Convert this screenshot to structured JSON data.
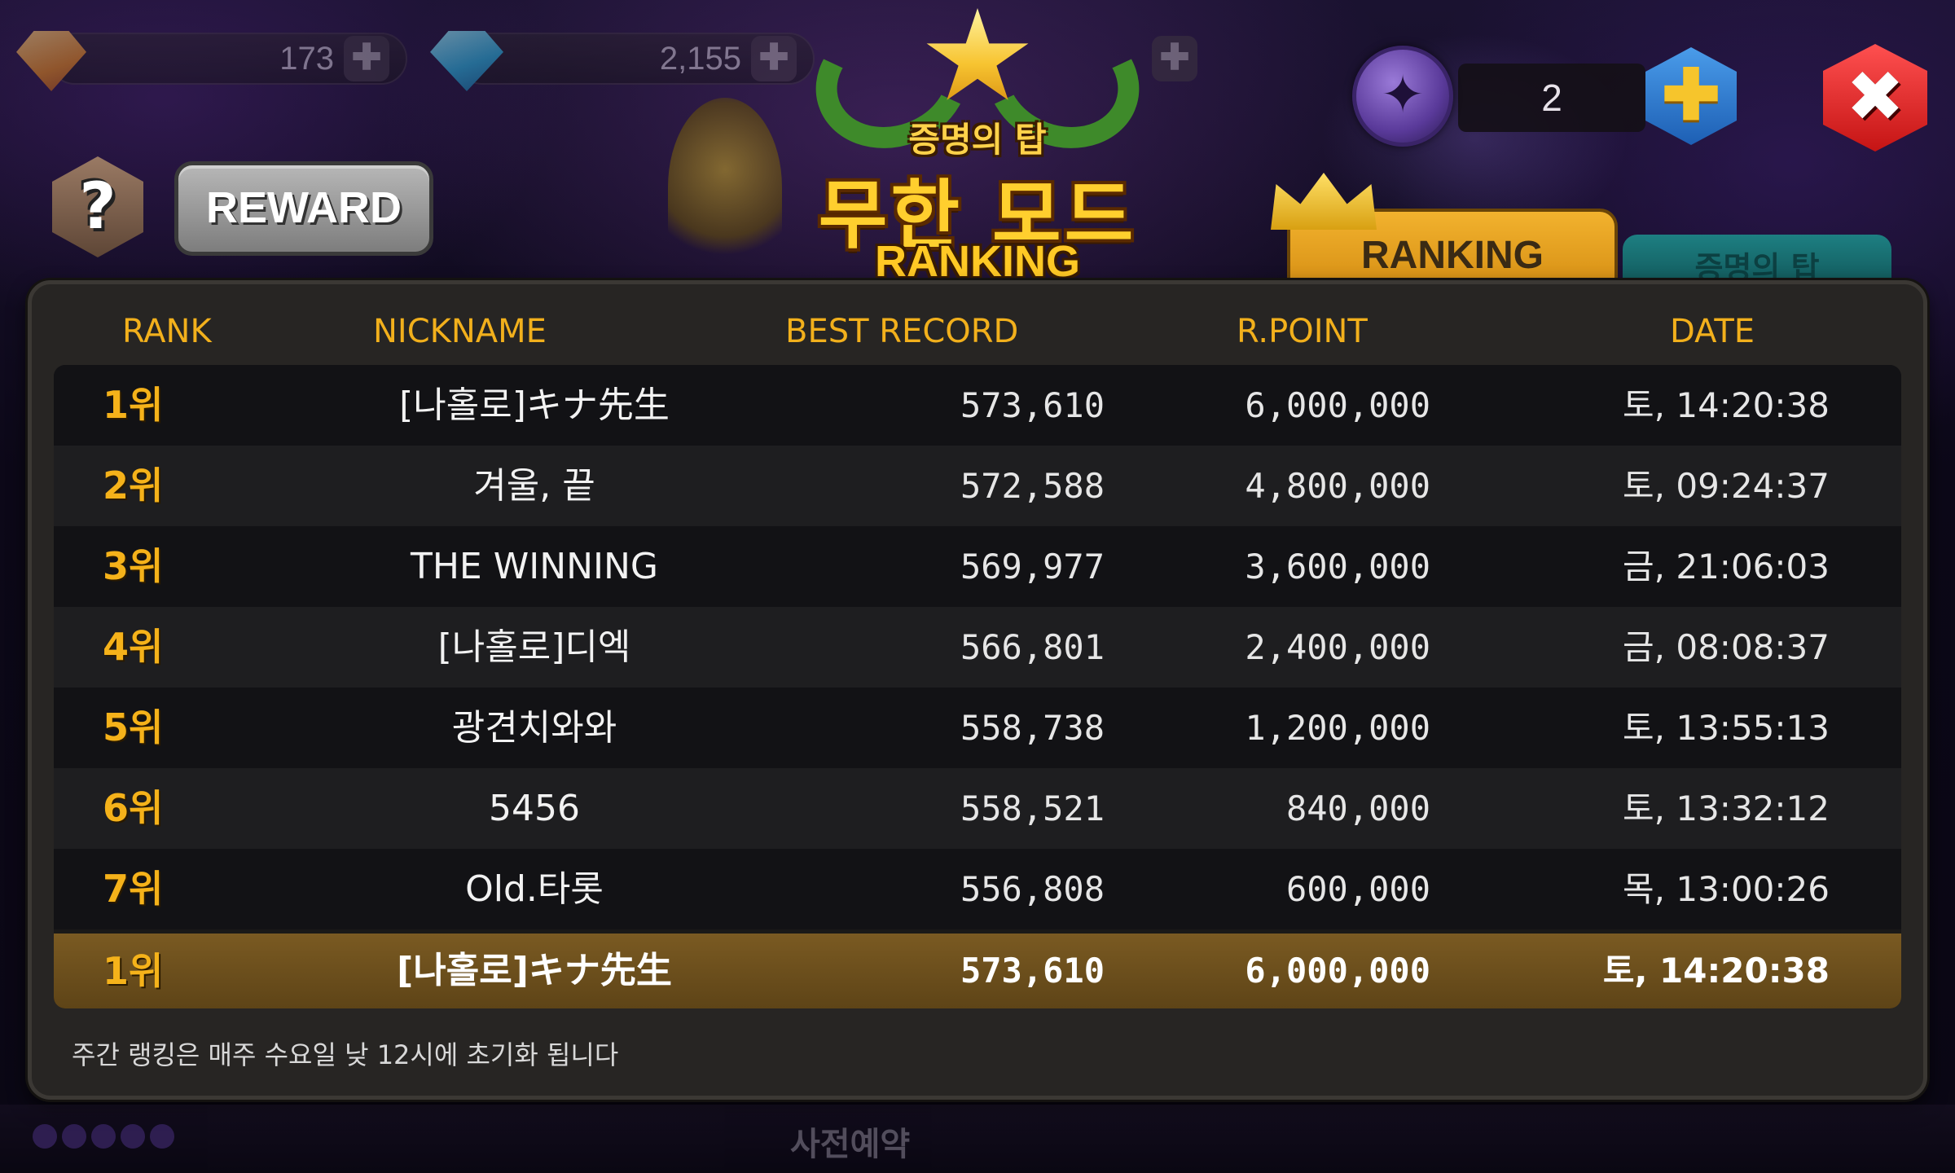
{
  "currencies": [
    {
      "name": "orange-gem",
      "value": "173"
    },
    {
      "name": "blue-gem",
      "value": "2,155"
    }
  ],
  "hud": {
    "coin_count": "2",
    "help_symbol": "?",
    "close_symbol": "✖",
    "plus_symbol": "✚"
  },
  "title": {
    "subtitle": "증명의 탑",
    "main": "무한 모드",
    "ranking": "RANKING"
  },
  "buttons": {
    "reward": "REWARD"
  },
  "tabs": {
    "ranking": "RANKING",
    "tower": "증명의 탑"
  },
  "table": {
    "headers": {
      "rank": "RANK",
      "nickname": "NICKNAME",
      "best_record": "BEST RECORD",
      "r_point": "R.POINT",
      "date": "DATE"
    },
    "rows": [
      {
        "rank": "1위",
        "nickname": "[나홀로]キナ先生",
        "best": "573,610",
        "rpoint": "6,000,000",
        "date": "토, 14:20:38"
      },
      {
        "rank": "2위",
        "nickname": "겨울, 끝",
        "best": "572,588",
        "rpoint": "4,800,000",
        "date": "토, 09:24:37"
      },
      {
        "rank": "3위",
        "nickname": "THE WINNING",
        "best": "569,977",
        "rpoint": "3,600,000",
        "date": "금, 21:06:03"
      },
      {
        "rank": "4위",
        "nickname": "[나홀로]디엑",
        "best": "566,801",
        "rpoint": "2,400,000",
        "date": "금, 08:08:37"
      },
      {
        "rank": "5위",
        "nickname": "광견치와와",
        "best": "558,738",
        "rpoint": "1,200,000",
        "date": "토, 13:55:13"
      },
      {
        "rank": "6위",
        "nickname": "5456",
        "best": "558,521",
        "rpoint": "840,000",
        "date": "토, 13:32:12"
      },
      {
        "rank": "7위",
        "nickname": "Old.타롯",
        "best": "556,808",
        "rpoint": "600,000",
        "date": "목, 13:00:26"
      }
    ],
    "my_row": {
      "rank": "1위",
      "nickname": "[나홀로]キナ先生",
      "best": "573,610",
      "rpoint": "6,000,000",
      "date": "토, 14:20:38"
    }
  },
  "footer_note": "주간 랭킹은 매주 수요일 낮 12시에 초기화 됩니다",
  "bottom": {
    "preorder": "사전예약"
  },
  "colors": {
    "accent_gold": "#f2b01c",
    "my_row": "#7a5a22",
    "close_red": "#e02020",
    "plus_blue": "#2f7fd0"
  }
}
